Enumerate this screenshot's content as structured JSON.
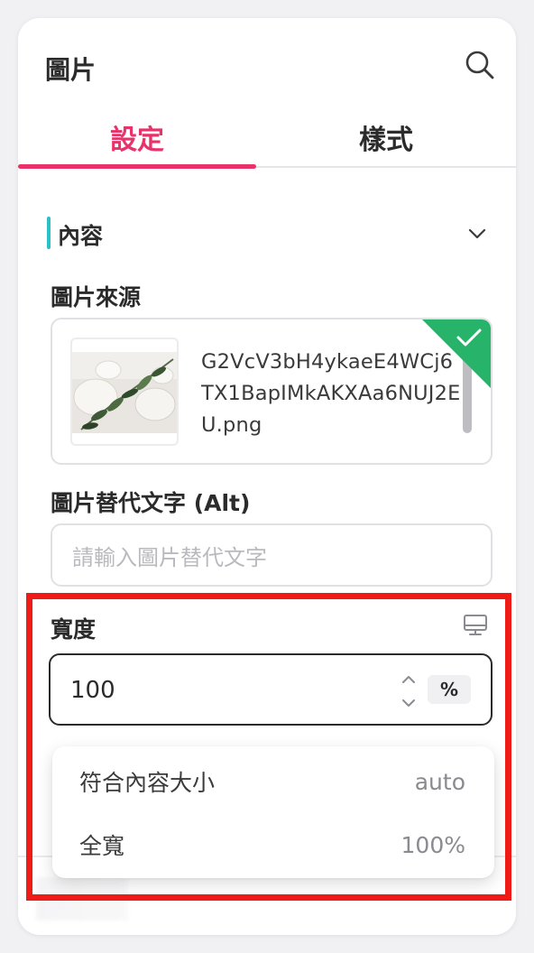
{
  "header": {
    "title": "圖片",
    "search_icon": "search-icon"
  },
  "tabs": [
    {
      "label": "設定",
      "active": true
    },
    {
      "label": "樣式",
      "active": false
    }
  ],
  "section": {
    "title": "內容",
    "toggle_icon": "chevron-down-icon"
  },
  "image_source": {
    "label": "圖片來源",
    "filename": "G2VcV3bH4ykaeE4WCj6TX1BapIMkAKXAa6NUJ2EU.png",
    "status_icon": "check-icon",
    "status_color": "#27b36a"
  },
  "alt_text": {
    "label": "圖片替代文字 (Alt)",
    "placeholder": "請輸入圖片替代文字"
  },
  "width": {
    "label": "寬度",
    "device_icon": "desktop-icon",
    "value": "100",
    "unit": "%",
    "options": [
      {
        "label": "符合內容大小",
        "value": "auto"
      },
      {
        "label": "全寬",
        "value": "100%"
      }
    ]
  },
  "colors": {
    "accent": "#e8326a",
    "section_bar": "#2bbfc8",
    "highlight": "#ef1b16"
  }
}
